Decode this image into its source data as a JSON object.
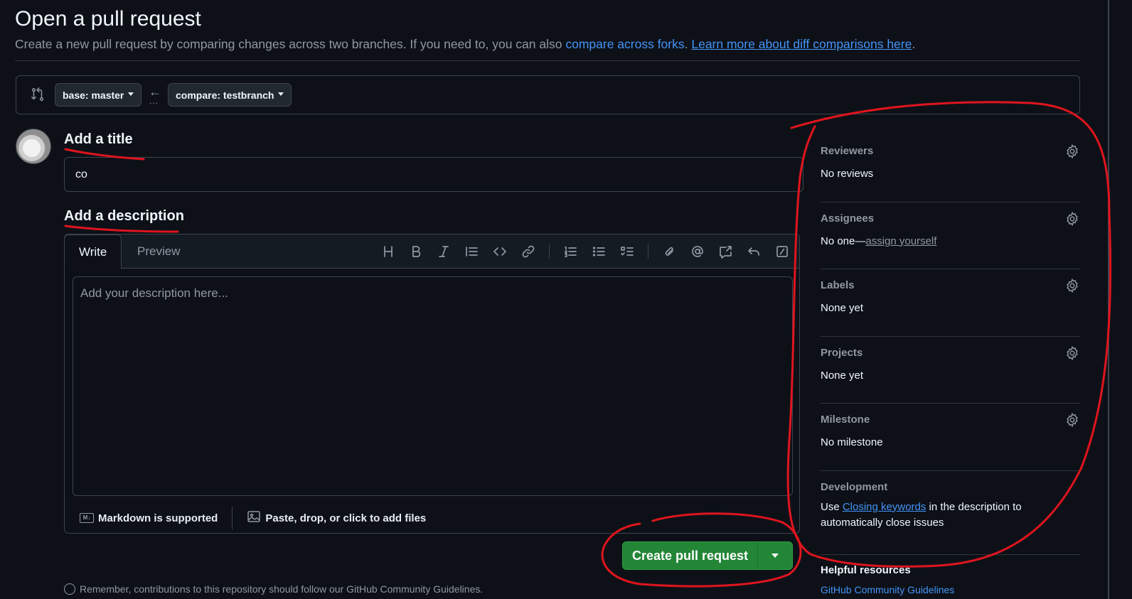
{
  "header": {
    "title": "Open a pull request",
    "subtitle_text": "Create a new pull request by comparing changes across two branches. If you need to, you can also ",
    "compare_forks_link": "compare across forks",
    "subtitle_sep": ". ",
    "learn_more_link": "Learn more about diff comparisons here",
    "subtitle_end": "."
  },
  "branches": {
    "base_label": "base: master",
    "compare_label": "compare: testbranch",
    "arrow": "←",
    "dots": "..."
  },
  "form": {
    "title_heading": "Add a title",
    "title_value": "co",
    "description_heading": "Add a description",
    "tabs": [
      "Write",
      "Preview"
    ],
    "description_placeholder": "Add your description here...",
    "markdown_note": "Markdown is supported",
    "markdown_icon_text": "M↓",
    "attach_note": "Paste, drop, or click to add files",
    "create_button": "Create pull request",
    "footnote": "Remember, contributions to this repository should follow our GitHub Community Guidelines."
  },
  "toolbar": [
    "heading-icon",
    "bold-icon",
    "italic-icon",
    "quote-icon",
    "code-icon",
    "link-icon",
    "ordered-list-icon",
    "unordered-list-icon",
    "task-list-icon",
    "attach-icon",
    "mention-icon",
    "cross-reference-icon",
    "reply-icon",
    "slash-commands-icon"
  ],
  "sidebar": {
    "reviewers": {
      "heading": "Reviewers",
      "value": "No reviews"
    },
    "assignees": {
      "heading": "Assignees",
      "value_prefix": "No one—",
      "link": "assign yourself"
    },
    "labels": {
      "heading": "Labels",
      "value": "None yet"
    },
    "projects": {
      "heading": "Projects",
      "value": "None yet"
    },
    "milestone": {
      "heading": "Milestone",
      "value": "No milestone"
    },
    "development": {
      "heading": "Development",
      "text_before": "Use ",
      "link": "Closing keywords",
      "text_after": " in the description to automatically close issues"
    },
    "helpful_heading": "Helpful resources",
    "helpful_link": "GitHub Community Guidelines"
  },
  "colors": {
    "background": "#0d1117",
    "accent_link": "#4493f8",
    "primary_button": "#238636",
    "annotation": "#e0141e"
  }
}
